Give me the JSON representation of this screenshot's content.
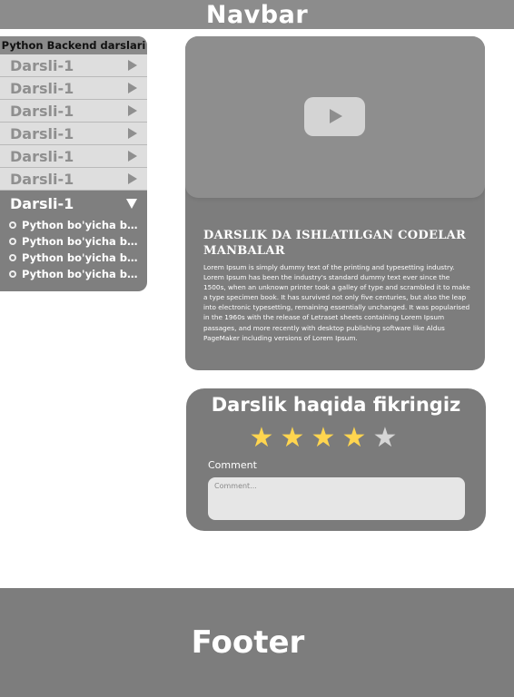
{
  "navbar": {
    "title": "Navbar"
  },
  "sidebar": {
    "header": "Python Backend darslari",
    "lessons": [
      {
        "label": "Darsli-1"
      },
      {
        "label": "Darsli-1"
      },
      {
        "label": "Darsli-1"
      },
      {
        "label": "Darsli-1"
      },
      {
        "label": "Darsli-1"
      },
      {
        "label": "Darsli-1"
      }
    ],
    "open_lesson": {
      "label": "Darsli-1",
      "subitems": [
        {
          "label": "Python bo'yicha birinchi dars"
        },
        {
          "label": "Python bo'yicha birinchi dars"
        },
        {
          "label": "Python bo'yicha birinchi dars"
        },
        {
          "label": "Python bo'yicha birinchi dars"
        }
      ]
    }
  },
  "video_card": {
    "title": "DARSLIK DA ISHLATILGAN CODELAR MANBALAR",
    "body": "Lorem Ipsum is simply dummy text of the printing and typesetting industry. Lorem Ipsum has been the industry's standard dummy text ever since the 1500s, when an unknown printer took a galley of type and scrambled it to make a type specimen book. It has survived not only five centuries, but also the leap into electronic typesetting, remaining essentially unchanged. It was popularised in the 1960s with the release of Letraset sheets containing Lorem Ipsum passages, and more recently with desktop publishing software like Aldus PageMaker including versions of Lorem Ipsum."
  },
  "feedback": {
    "title": "Darslik haqida fikringiz",
    "rating": 4,
    "max_rating": 5,
    "comment_label": "Comment",
    "comment_placeholder": "Comment...",
    "comment_value": ""
  },
  "footer": {
    "title": "Footer"
  },
  "colors": {
    "navbar_bg": "#8c8c8c",
    "panel_bg": "#7d7d7d",
    "star_on": "#ffd54f",
    "star_off": "#d6d6d6"
  },
  "icons": {
    "play": "play-icon",
    "collapsed_arrow": "triangle-right-icon",
    "expanded_arrow": "triangle-down-icon",
    "bullet": "circle-bullet-icon",
    "star": "star-icon"
  }
}
